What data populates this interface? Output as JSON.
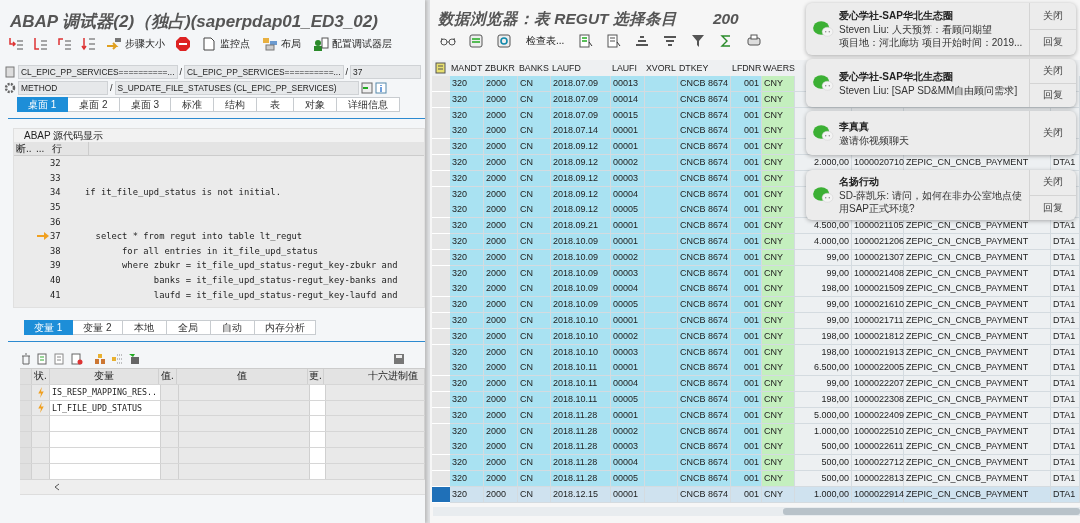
{
  "debugger": {
    "title": "ABAP 调试器(2)（独占)(saperpdap01_ED3_02)",
    "toolbar": [
      "步骤大小",
      "监控点",
      "布局",
      "配置调试器层"
    ],
    "location": {
      "program": "CL_EPIC_PP_SERVICES==========...",
      "include": "CL_EPIC_PP_SERVICES==========...",
      "line": "37",
      "type": "METHOD",
      "method": "S_UPDATE_FILE_STATUSES (CL_EPIC_PP_SERVICES)",
      "separators": [
        "/",
        "/",
        "/"
      ]
    },
    "tabs": [
      {
        "label": "桌面 1",
        "selected": true
      },
      {
        "label": "桌面 2",
        "selected": false
      },
      {
        "label": "桌面 3",
        "selected": false
      },
      {
        "label": "标准",
        "selected": false
      },
      {
        "label": "结构",
        "selected": false
      },
      {
        "label": "表",
        "selected": false
      },
      {
        "label": "对象",
        "selected": false
      },
      {
        "label": "详细信息",
        "selected": false
      }
    ],
    "source": {
      "title": "ABAP 源代码显示",
      "columns": [
        "断..",
        "...",
        "行"
      ],
      "lines": [
        {
          "number": "32",
          "current": false
        },
        {
          "number": "33",
          "current": false
        },
        {
          "number": "34",
          "code": "if it_file_upd_status is not initial.",
          "current": false
        },
        {
          "number": "35",
          "current": false
        },
        {
          "number": "36",
          "current": false
        },
        {
          "number": "37",
          "code": "  select * from regut into table lt_regut",
          "current": true
        },
        {
          "number": "38",
          "code": "       for all entries in it_file_upd_status",
          "current": false
        },
        {
          "number": "39",
          "code": "       where zbukr = it_file_upd_status-regut_key-zbukr and",
          "current": false
        },
        {
          "number": "40",
          "code": "             banks = it_file_upd_status-regut_key-banks and",
          "current": false
        },
        {
          "number": "41",
          "code": "             laufd = it_file_upd_status-regut_key-laufd and",
          "current": false
        }
      ]
    },
    "variable_tabs": [
      {
        "label": "变量 1",
        "selected": true
      },
      {
        "label": "变量 2",
        "selected": false
      },
      {
        "label": "本地",
        "selected": false
      },
      {
        "label": "全局",
        "selected": false
      },
      {
        "label": "自动",
        "selected": false
      },
      {
        "label": "内存分析",
        "selected": false
      }
    ],
    "variables": {
      "columns": [
        "状.",
        "变量",
        "值.",
        "值",
        "更.",
        "十六进制值"
      ],
      "rows": [
        {
          "name": "IS_RESP_MAPPING_RES.."
        },
        {
          "name": "LT_FILE_UPD_STATUS"
        }
      ]
    }
  },
  "data_browser": {
    "title": "数据浏览器：表 REGUT 选择条目",
    "count": "200",
    "toolbar_button": "检查表...",
    "columns": [
      "MANDT",
      "ZBUKR",
      "BANKS",
      "LAUFD",
      "LAUFI",
      "XVORL",
      "DTKEY",
      "LFDNR",
      "WAERS"
    ],
    "rows": [
      {
        "cells": [
          "320",
          "2000",
          "CN",
          "2018.07.09",
          "00013",
          null,
          "CNCB 8674",
          "001",
          "CNY",
          null,
          null,
          null,
          null
        ],
        "selected": false
      },
      {
        "cells": [
          "320",
          "2000",
          "CN",
          "2018.07.09",
          "00014",
          null,
          "CNCB 8674",
          "001",
          "CNY",
          null,
          null,
          null,
          null
        ],
        "selected": false
      },
      {
        "cells": [
          "320",
          "2000",
          "CN",
          "2018.07.09",
          "00015",
          null,
          "CNCB 8674",
          "001",
          "CNY",
          null,
          null,
          null,
          null
        ],
        "selected": false
      },
      {
        "cells": [
          "320",
          "2000",
          "CN",
          "2018.07.14",
          "00001",
          null,
          "CNCB 8674",
          "001",
          "CNY",
          null,
          null,
          null,
          null
        ],
        "selected": false
      },
      {
        "cells": [
          "320",
          "2000",
          "CN",
          "2018.09.12",
          "00001",
          null,
          "CNCB 8674",
          "001",
          "CNY",
          null,
          null,
          null,
          null
        ],
        "selected": false
      },
      {
        "cells": [
          "320",
          "2000",
          "CN",
          "2018.09.12",
          "00002",
          null,
          "CNCB 8674",
          "001",
          "CNY",
          "2.000,00",
          "1000020710",
          "ZEPIC_CN_CNCB_PAYMENT",
          "DTA1"
        ],
        "selected": false
      },
      {
        "cells": [
          "320",
          "2000",
          "CN",
          "2018.09.12",
          "00003",
          null,
          "CNCB 8674",
          "001",
          "CNY",
          null,
          null,
          null,
          null
        ],
        "selected": false
      },
      {
        "cells": [
          "320",
          "2000",
          "CN",
          "2018.09.12",
          "00004",
          null,
          "CNCB 8674",
          "001",
          "CNY",
          null,
          null,
          null,
          null
        ],
        "selected": false
      },
      {
        "cells": [
          "320",
          "2000",
          "CN",
          "2018.09.12",
          "00005",
          null,
          "CNCB 8674",
          "001",
          "CNY",
          null,
          null,
          null,
          null
        ],
        "selected": false
      },
      {
        "cells": [
          "320",
          "2000",
          "CN",
          "2018.09.21",
          "00001",
          null,
          "CNCB 8674",
          "001",
          "CNY",
          "4.500,00",
          "1000021105",
          "ZEPIC_CN_CNCB_PAYMENT",
          "DTA1"
        ],
        "selected": false
      },
      {
        "cells": [
          "320",
          "2000",
          "CN",
          "2018.10.09",
          "00001",
          null,
          "CNCB 8674",
          "001",
          "CNY",
          "4.000,00",
          "1000021206",
          "ZEPIC_CN_CNCB_PAYMENT",
          "DTA1"
        ],
        "selected": false
      },
      {
        "cells": [
          "320",
          "2000",
          "CN",
          "2018.10.09",
          "00002",
          null,
          "CNCB 8674",
          "001",
          "CNY",
          "99,00",
          "1000021307",
          "ZEPIC_CN_CNCB_PAYMENT",
          "DTA1"
        ],
        "selected": false
      },
      {
        "cells": [
          "320",
          "2000",
          "CN",
          "2018.10.09",
          "00003",
          null,
          "CNCB 8674",
          "001",
          "CNY",
          "99,00",
          "1000021408",
          "ZEPIC_CN_CNCB_PAYMENT",
          "DTA1"
        ],
        "selected": false
      },
      {
        "cells": [
          "320",
          "2000",
          "CN",
          "2018.10.09",
          "00004",
          null,
          "CNCB 8674",
          "001",
          "CNY",
          "198,00",
          "1000021509",
          "ZEPIC_CN_CNCB_PAYMENT",
          "DTA1"
        ],
        "selected": false
      },
      {
        "cells": [
          "320",
          "2000",
          "CN",
          "2018.10.09",
          "00005",
          null,
          "CNCB 8674",
          "001",
          "CNY",
          "99,00",
          "1000021610",
          "ZEPIC_CN_CNCB_PAYMENT",
          "DTA1"
        ],
        "selected": false
      },
      {
        "cells": [
          "320",
          "2000",
          "CN",
          "2018.10.10",
          "00001",
          null,
          "CNCB 8674",
          "001",
          "CNY",
          "99,00",
          "1000021711",
          "ZEPIC_CN_CNCB_PAYMENT",
          "DTA1"
        ],
        "selected": false
      },
      {
        "cells": [
          "320",
          "2000",
          "CN",
          "2018.10.10",
          "00002",
          null,
          "CNCB 8674",
          "001",
          "CNY",
          "198,00",
          "1000021812",
          "ZEPIC_CN_CNCB_PAYMENT",
          "DTA1"
        ],
        "selected": false
      },
      {
        "cells": [
          "320",
          "2000",
          "CN",
          "2018.10.10",
          "00003",
          null,
          "CNCB 8674",
          "001",
          "CNY",
          "198,00",
          "1000021913",
          "ZEPIC_CN_CNCB_PAYMENT",
          "DTA1"
        ],
        "selected": false
      },
      {
        "cells": [
          "320",
          "2000",
          "CN",
          "2018.10.11",
          "00001",
          null,
          "CNCB 8674",
          "001",
          "CNY",
          "6.500,00",
          "1000022005",
          "ZEPIC_CN_CNCB_PAYMENT",
          "DTA1"
        ],
        "selected": false
      },
      {
        "cells": [
          "320",
          "2000",
          "CN",
          "2018.10.11",
          "00004",
          null,
          "CNCB 8674",
          "001",
          "CNY",
          "99,00",
          "1000022207",
          "ZEPIC_CN_CNCB_PAYMENT",
          "DTA1"
        ],
        "selected": false
      },
      {
        "cells": [
          "320",
          "2000",
          "CN",
          "2018.10.11",
          "00005",
          null,
          "CNCB 8674",
          "001",
          "CNY",
          "198,00",
          "1000022308",
          "ZEPIC_CN_CNCB_PAYMENT",
          "DTA1"
        ],
        "selected": false
      },
      {
        "cells": [
          "320",
          "2000",
          "CN",
          "2018.11.28",
          "00001",
          null,
          "CNCB 8674",
          "001",
          "CNY",
          "5.000,00",
          "1000022409",
          "ZEPIC_CN_CNCB_PAYMENT",
          "DTA1"
        ],
        "selected": false
      },
      {
        "cells": [
          "320",
          "2000",
          "CN",
          "2018.11.28",
          "00002",
          null,
          "CNCB 8674",
          "001",
          "CNY",
          "1.000,00",
          "1000022510",
          "ZEPIC_CN_CNCB_PAYMENT",
          "DTA1"
        ],
        "selected": false
      },
      {
        "cells": [
          "320",
          "2000",
          "CN",
          "2018.11.28",
          "00003",
          null,
          "CNCB 8674",
          "001",
          "CNY",
          "500,00",
          "1000022611",
          "ZEPIC_CN_CNCB_PAYMENT",
          "DTA1"
        ],
        "selected": false
      },
      {
        "cells": [
          "320",
          "2000",
          "CN",
          "2018.11.28",
          "00004",
          null,
          "CNCB 8674",
          "001",
          "CNY",
          "500,00",
          "1000022712",
          "ZEPIC_CN_CNCB_PAYMENT",
          "DTA1"
        ],
        "selected": false
      },
      {
        "cells": [
          "320",
          "2000",
          "CN",
          "2018.11.28",
          "00005",
          null,
          "CNCB 8674",
          "001",
          "CNY",
          "500,00",
          "1000022813",
          "ZEPIC_CN_CNCB_PAYMENT",
          "DTA1"
        ],
        "selected": false
      },
      {
        "cells": [
          "320",
          "2000",
          "CN",
          "2018.12.15",
          "00001",
          null,
          "CNCB 8674",
          "001",
          "CNY",
          "1.000,00",
          "1000022914",
          "ZEPIC_CN_CNCB_PAYMENT",
          "DTA1"
        ],
        "selected": true
      }
    ]
  },
  "notifications": [
    {
      "title": "爱心学社-SAP华北生态圈",
      "lines": [
        "Steven Liu: 人天预算：看顾问期望",
        "项目地：河北廊坊 项目开始时间：2019..."
      ],
      "buttons": [
        "关闭",
        "回复"
      ]
    },
    {
      "title": "爱心学社-SAP华北生态圈",
      "lines": [
        "Steven Liu: [SAP SD&MM自由顾问需求]"
      ],
      "buttons": [
        "关闭",
        "回复"
      ]
    },
    {
      "title": "李真真",
      "lines": [
        "邀请你视频聊天"
      ],
      "buttons": [
        "关闭"
      ]
    },
    {
      "title": "名扬行动",
      "lines": [
        "SD-薛凯乐: 请问，如何在非办公室地点使",
        "用SAP正式环境?"
      ],
      "buttons": [
        "关闭",
        "回复"
      ]
    }
  ]
}
